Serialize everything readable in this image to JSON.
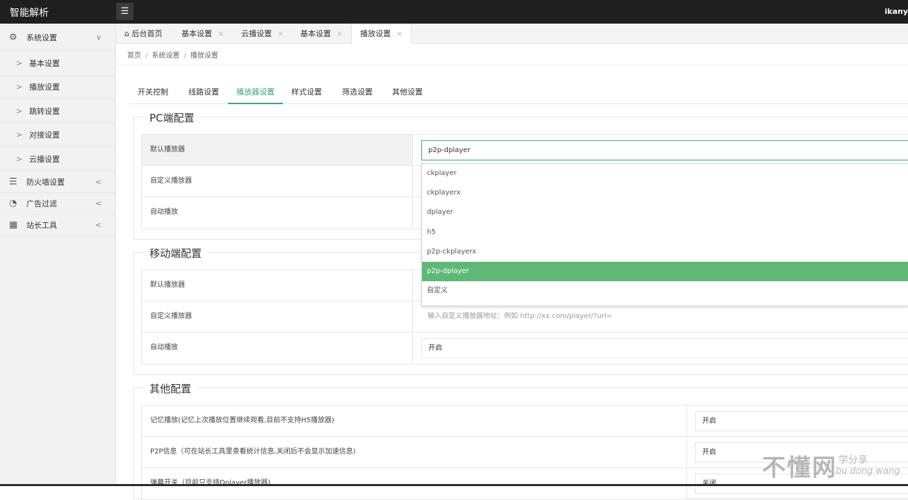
{
  "app": {
    "brand": "智能解析",
    "user": "ikany",
    "menu_icon": "list-icon"
  },
  "sidebar": {
    "group_system": {
      "label": "系统设置",
      "icon": "gear-icon",
      "arrow": "∨"
    },
    "items": [
      {
        "label": "基本设置"
      },
      {
        "label": "播放设置"
      },
      {
        "label": "跳转设置"
      },
      {
        "label": "对接设置"
      },
      {
        "label": "云播设置"
      }
    ],
    "group_firewall": {
      "label": "防火墙设置",
      "icon": "list-icon",
      "arrow": "<"
    },
    "group_ad": {
      "label": "广告过滤",
      "icon": "dashboard-icon",
      "arrow": "<"
    },
    "group_tools": {
      "label": "站长工具",
      "icon": "grid-icon",
      "arrow": "<"
    },
    "sub_arrow": ">"
  },
  "tabs": [
    {
      "label": "后台首页",
      "icon": "home-icon"
    },
    {
      "label": "基本设置",
      "close": "×"
    },
    {
      "label": "云播设置",
      "close": "×"
    },
    {
      "label": "基本设置",
      "close": "×"
    },
    {
      "label": "播放设置",
      "close": "×"
    }
  ],
  "breadcrumb": {
    "items": [
      "首页",
      "系统设置",
      "播放设置"
    ],
    "sep": "/"
  },
  "subtabs": [
    "开关控制",
    "线路设置",
    "播放器设置",
    "样式设置",
    "筛选设置",
    "其他设置"
  ],
  "pc": {
    "legend": "PC端配置",
    "rows": [
      {
        "label": "默认播放器",
        "value": "p2p-dplayer"
      },
      {
        "label": "自定义播放器",
        "value": ""
      },
      {
        "label": "自动播放",
        "value": ""
      }
    ]
  },
  "dropdown": {
    "options": [
      "ckplayer",
      "ckplayerx",
      "dplayer",
      "h5",
      "p2p-ckplayerx",
      "p2p-dplayer",
      "自定义"
    ],
    "selected": "p2p-dplayer"
  },
  "mobile": {
    "legend": "移动端配置",
    "rows": [
      {
        "label": "默认播放器",
        "value": ""
      },
      {
        "label": "自定义播放器",
        "placeholder": "输入自定义播放器地址：例如 http://xx.com/player/?url="
      },
      {
        "label": "自动播放",
        "value": "开启"
      }
    ]
  },
  "other": {
    "legend": "其他配置",
    "rows": [
      {
        "label": "记忆播放(记忆上次播放位置继续观看,目前不支持H5播放器)",
        "value": "开启"
      },
      {
        "label": "P2P信息（可在站长工具里查看统计信息,关闭后不会显示加速信息)",
        "value": "开启"
      },
      {
        "label": "弹幕开关（目前只支持Dplayer播放器)",
        "value": "关闭"
      }
    ]
  },
  "watermark": {
    "big": "不懂网",
    "small1": "学分享",
    "small2": "bu dong wang"
  }
}
